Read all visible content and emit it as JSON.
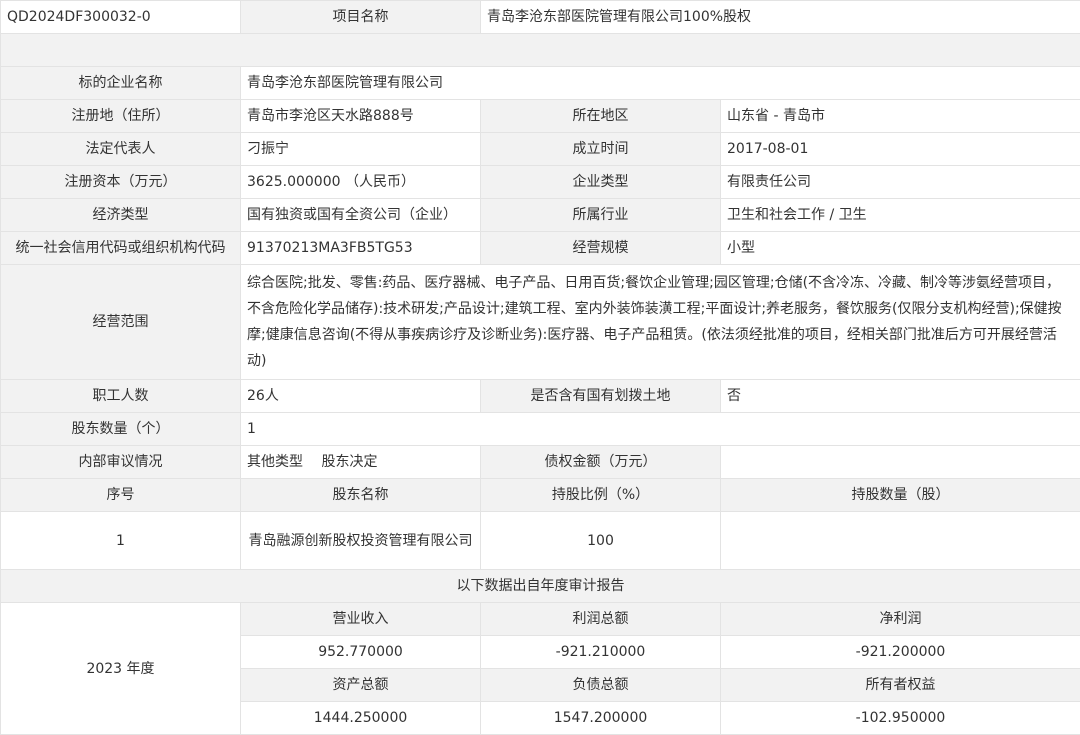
{
  "header": {
    "code": "QD2024DF300032-0",
    "project_label": "项目名称",
    "project_name": "青岛李沧东部医院管理有限公司100%股权"
  },
  "company": {
    "name_label": "标的企业名称",
    "name": "青岛李沧东部医院管理有限公司",
    "address_label": "注册地（住所）",
    "address": "青岛市李沧区天水路888号",
    "region_label": "所在地区",
    "region": "山东省 - 青岛市",
    "legal_rep_label": "法定代表人",
    "legal_rep": "刁振宁",
    "founded_label": "成立时间",
    "founded": "2017-08-01",
    "capital_label": "注册资本（万元）",
    "capital": "3625.000000 （人民币）",
    "company_type_label": "企业类型",
    "company_type": "有限责任公司",
    "economy_type_label": "经济类型",
    "economy_type": "国有独资或国有全资公司（企业）",
    "industry_label": "所属行业",
    "industry": "卫生和社会工作 / 卫生",
    "credit_code_label": "统一社会信用代码或组织机构代码",
    "credit_code": "91370213MA3FB5TG53",
    "scale_label": "经营规模",
    "scale": "小型",
    "scope_label": "经营范围",
    "scope": "综合医院;批发、零售:药品、医疗器械、电子产品、日用百货;餐饮企业管理;园区管理;仓储(不含冷冻、冷藏、制冷等涉氨经营项目，不含危险化学品储存):技术研发;产品设计;建筑工程、室内外装饰装潢工程;平面设计;养老服务，餐饮服务(仅限分支机构经营);保健按摩;健康信息咨询(不得从事疾病诊疗及诊断业务):医疗器、电子产品租赁。(依法须经批准的项目，经相关部门批准后方可开展经营活动)",
    "employees_label": "职工人数",
    "employees": "26人",
    "land_label": "是否含有国有划拨土地",
    "land": "否",
    "shareholder_count_label": "股东数量（个）",
    "shareholder_count": "1",
    "audit_label": "内部审议情况",
    "audit": "其他类型　 股东决定",
    "debt_label": "债权金额（万元）",
    "debt": ""
  },
  "shareholders": {
    "headers": [
      "序号",
      "股东名称",
      "持股比例（%）",
      "持股数量（股）"
    ],
    "rows": [
      {
        "index": "1",
        "name": "青岛融源创新股权投资管理有限公司",
        "ratio": "100",
        "quantity": ""
      }
    ]
  },
  "financial": {
    "source_note": "以下数据出自年度审计报告",
    "year": "2023 年度",
    "row1_headers": [
      "营业收入",
      "利润总额",
      "净利润"
    ],
    "row1_values": [
      "952.770000",
      "-921.210000",
      "-921.200000"
    ],
    "row2_headers": [
      "资产总额",
      "负债总额",
      "所有者权益"
    ],
    "row2_values": [
      "1444.250000",
      "1547.200000",
      "-102.950000"
    ]
  }
}
